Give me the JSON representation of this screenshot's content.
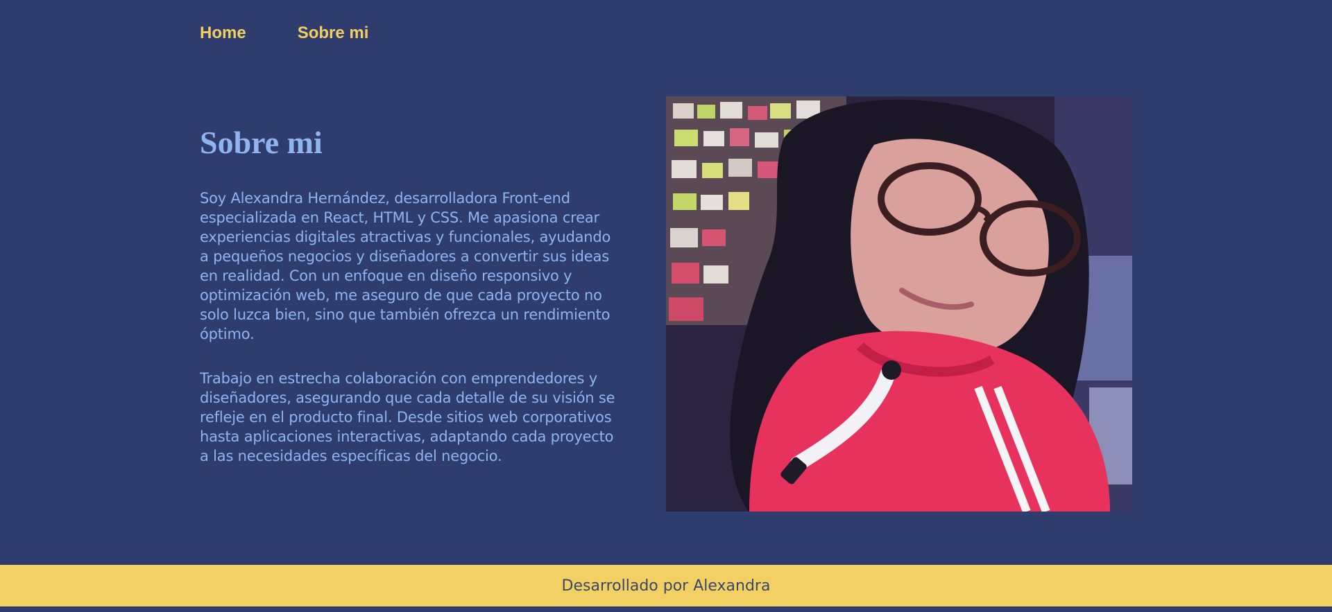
{
  "nav": {
    "items": [
      {
        "label": "Home"
      },
      {
        "label": "Sobre mi"
      }
    ]
  },
  "about": {
    "title": "Sobre mi",
    "paragraphs": [
      "Soy Alexandra Hernández, desarrolladora Front-end especializada en React, HTML y CSS. Me apasiona crear experiencias digitales atractivas y funcionales, ayudando a pequeños negocios y diseñadores a convertir sus ideas en realidad. Con un enfoque en diseño responsivo y optimización web, me aseguro de que cada proyecto no solo luzca bien, sino que también ofrezca un rendimiento óptimo.",
      "Trabajo en estrecha colaboración con emprendedores y diseñadores, asegurando que cada detalle de su visión se refleje en el producto final. Desde sitios web corporativos hasta aplicaciones interactivas, adaptando cada proyecto a las necesidades específicas del negocio."
    ]
  },
  "footer": {
    "text": "Desarrollado por Alexandra"
  },
  "colors": {
    "background": "#2e3d6e",
    "nav_link": "#f3cf61",
    "text": "#8fb4f0",
    "footer_bg": "#f3d064",
    "footer_text": "#3a4766"
  }
}
